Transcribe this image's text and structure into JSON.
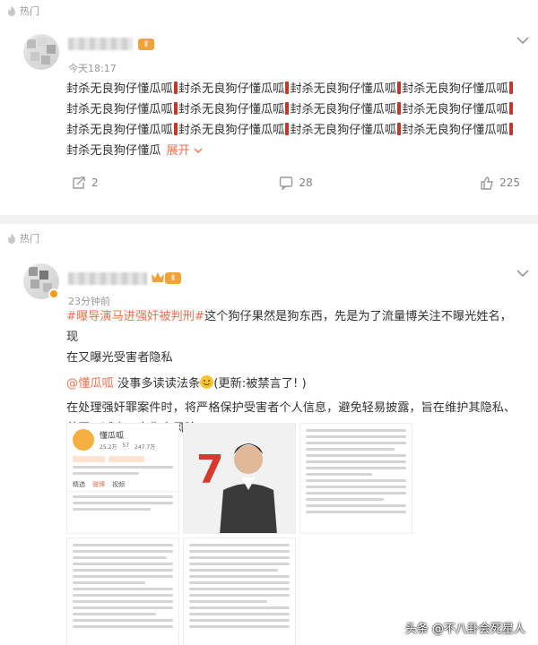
{
  "post1": {
    "section_label": "热门",
    "time": "今天18:17",
    "level": "Ⅱ",
    "lines": [
      [
        "封杀无良狗仔懂瓜呱",
        "封杀无良狗仔懂瓜呱",
        "封杀无良狗仔懂瓜呱",
        "封杀无良狗仔懂瓜呱"
      ],
      [
        "封杀无良狗仔懂瓜呱",
        "封杀无良狗仔懂瓜呱",
        "封杀无良狗仔懂瓜呱",
        "封杀无良狗仔懂瓜呱"
      ],
      [
        "封杀无良狗仔懂瓜呱",
        "封杀无良狗仔懂瓜呱",
        "封杀无良狗仔懂瓜呱",
        "封杀无良狗仔懂瓜呱"
      ]
    ],
    "last_line": "封杀无良狗仔懂瓜",
    "expand_label": "展开",
    "repost_count": "2",
    "comment_count": "28",
    "like_count": "225"
  },
  "post2": {
    "section_label": "热门",
    "time": "23分钟前",
    "level": "Ⅱ",
    "topic": "#曝导演马进强奸被判刑#",
    "text_line1": "这个狗仔果然是狗东西，先是为了流量博关注不曝光姓名，现",
    "text_line2": "在又曝光受害者隐私",
    "mention": "@懂瓜呱",
    "text_line3a": " 没事多读读法条",
    "text_line3b": "(更新:被禁言了! )",
    "text_line4": "在处理强奸罪案件时，将严格保护受害者个人信息，避免轻易披露，旨在维护其隐私、",
    "text_line5": "尊严，减少二次伤害风险。"
  },
  "thumb1": {
    "username": "懂瓜呱",
    "stats": [
      "25.2万",
      "57",
      "247.7万"
    ],
    "tabs": [
      "精选",
      "微博",
      "视频"
    ]
  },
  "thumb2": {
    "big_number": "7"
  },
  "watermark": "头条 @不八卦会死星人"
}
